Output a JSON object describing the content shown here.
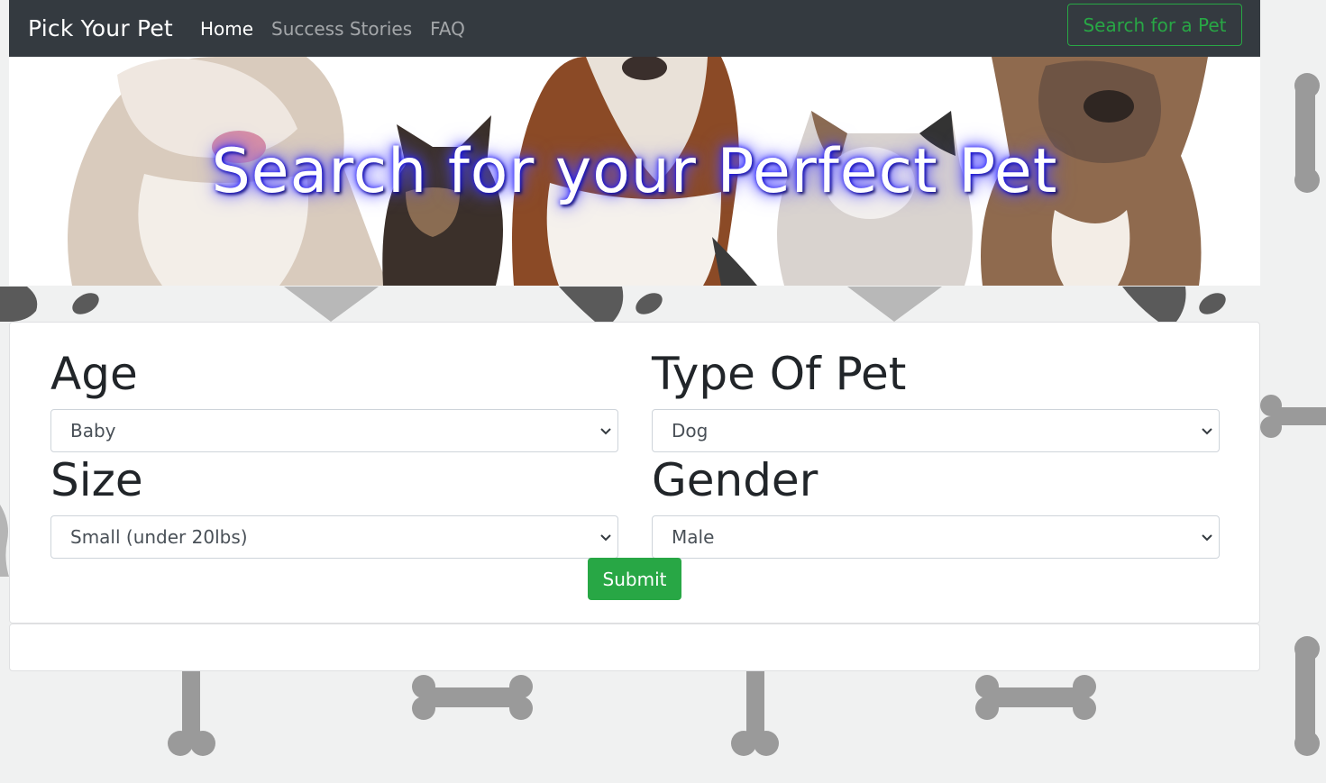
{
  "navbar": {
    "brand": "Pick Your Pet",
    "links": [
      {
        "label": "Home",
        "active": true
      },
      {
        "label": "Success Stories",
        "active": false
      },
      {
        "label": "FAQ",
        "active": false
      }
    ],
    "search_button": "Search for a Pet"
  },
  "hero": {
    "title": "Search for your Perfect Pet"
  },
  "form": {
    "age": {
      "label": "Age",
      "value": "Baby"
    },
    "type": {
      "label": "Type Of Pet",
      "value": "Dog"
    },
    "size": {
      "label": "Size",
      "value": "Small (under 20lbs)"
    },
    "gender": {
      "label": "Gender",
      "value": "Male"
    },
    "submit_label": "Submit"
  },
  "colors": {
    "navbar_bg": "#343a40",
    "accent_green": "#28a745",
    "page_bg": "#f0f1f1",
    "title_glow": "#3a32ff"
  }
}
